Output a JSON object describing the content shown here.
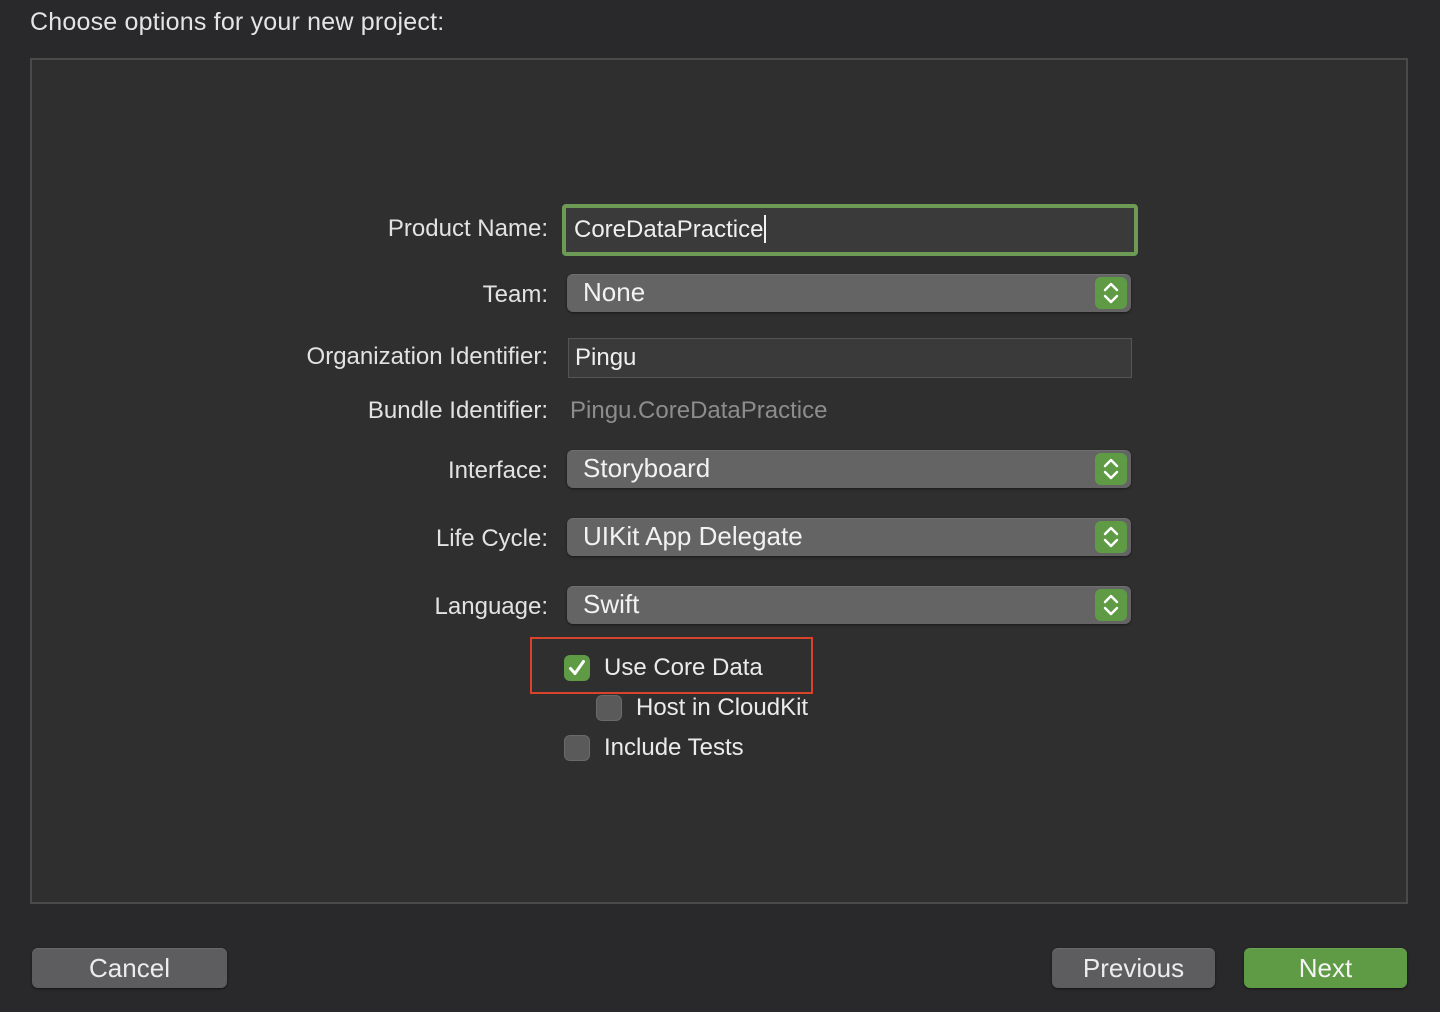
{
  "header": {
    "title": "Choose options for your new project:"
  },
  "form": {
    "product_name": {
      "label": "Product Name:",
      "value": "CoreDataPractice"
    },
    "team": {
      "label": "Team:",
      "value": "None"
    },
    "organization_identifier": {
      "label": "Organization Identifier:",
      "value": "Pingu"
    },
    "bundle_identifier": {
      "label": "Bundle Identifier:",
      "value": "Pingu.CoreDataPractice"
    },
    "interface": {
      "label": "Interface:",
      "value": "Storyboard"
    },
    "life_cycle": {
      "label": "Life Cycle:",
      "value": "UIKit App Delegate"
    },
    "language": {
      "label": "Language:",
      "value": "Swift"
    }
  },
  "options": {
    "use_core_data": {
      "label": "Use Core Data",
      "checked": true
    },
    "host_in_cloudkit": {
      "label": "Host in CloudKit",
      "checked": false
    },
    "include_tests": {
      "label": "Include Tests",
      "checked": false
    }
  },
  "footer": {
    "cancel_label": "Cancel",
    "previous_label": "Previous",
    "next_label": "Next"
  },
  "colors": {
    "accent": "#5f9b45",
    "highlight": "#d8432c",
    "background": "#29292b",
    "panel": "#2f2f2f"
  },
  "icons": {
    "popup_indicator": "chevron-up-down-icon",
    "checkmark": "checkmark-icon"
  }
}
